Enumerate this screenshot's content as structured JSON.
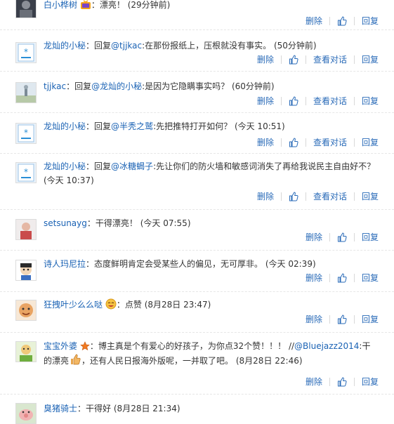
{
  "comments": [
    {
      "user": "白小桦树",
      "emoji_after_user": "tv-badge-icon",
      "colon": "：",
      "text": "漂亮！",
      "time": "(29分钟前)",
      "actions": {
        "delete": "删除",
        "view_dialog": null,
        "reply": "回复"
      }
    },
    {
      "user": "龙灿的小秘",
      "colon": "：",
      "reply_prefix": "回复",
      "mention": "@tjjkac",
      "text": ":在那份报纸上，压根就没有事实。",
      "time": "(50分钟前)",
      "actions": {
        "delete": "删除",
        "view_dialog": "查看对话",
        "reply": "回复"
      }
    },
    {
      "user": "tjjkac",
      "colon": "：",
      "reply_prefix": "回复",
      "mention": "@龙灿的小秘",
      "text": ":是因为它隐瞒事实吗？",
      "time": "(60分钟前)",
      "actions": {
        "delete": "删除",
        "view_dialog": "查看对话",
        "reply": "回复"
      }
    },
    {
      "user": "龙灿的小秘",
      "colon": "：",
      "reply_prefix": "回复",
      "mention": "@半秃之鹫",
      "text": ":先把推特打开如何？",
      "time": "(今天 10:51)",
      "actions": {
        "delete": "删除",
        "view_dialog": "查看对话",
        "reply": "回复"
      }
    },
    {
      "user": "龙灿的小秘",
      "colon": "：",
      "reply_prefix": "回复",
      "mention": "@冰糖蝎子",
      "text": ":先让你们的防火墙和敏感词消失了再给我说民主自由好不？",
      "time": "(今天 10:37)",
      "actions": {
        "delete": "删除",
        "view_dialog": "查看对话",
        "reply": "回复"
      }
    },
    {
      "user": "setsunayg",
      "colon": "：",
      "text": "干得漂亮！",
      "time": "(今天 07:55)",
      "actions": {
        "delete": "删除",
        "view_dialog": null,
        "reply": "回复"
      }
    },
    {
      "user": "诗人玛尼拉",
      "colon": "：",
      "text": "态度鲜明肯定会受某些人的偏见，无可厚非。",
      "time": "(今天 02:39)",
      "actions": {
        "delete": "删除",
        "view_dialog": null,
        "reply": "回复"
      }
    },
    {
      "user": "狂拽叶少么么哒",
      "emoji_after_user": "laugh-face-icon",
      "colon": "：",
      "text": "点赞",
      "time": "(8月28日 23:47)",
      "actions": {
        "delete": "删除",
        "view_dialog": null,
        "reply": "回复"
      }
    },
    {
      "user": "宝宝外婆",
      "emoji_after_user": "star-badge-icon",
      "colon": "：",
      "text": "博主真是个有爱心的好孩子，为你点32个赞！！！ //",
      "mention": "@Bluejazz2014",
      "text2": ":干的漂亮",
      "text3": "，还有人民日报海外版呢，一并取了吧。",
      "time": "(8月28日 22:46)",
      "actions": {
        "delete": "删除",
        "view_dialog": null,
        "reply": "回复"
      }
    },
    {
      "user": "臭猪骑士",
      "colon": "：",
      "text": "干得好",
      "time": "(8月28日 21:34)",
      "actions": null
    }
  ],
  "colors": {
    "link": "#1a62b4",
    "action": "#2a6bb8",
    "separator": "#d8d8d8"
  }
}
